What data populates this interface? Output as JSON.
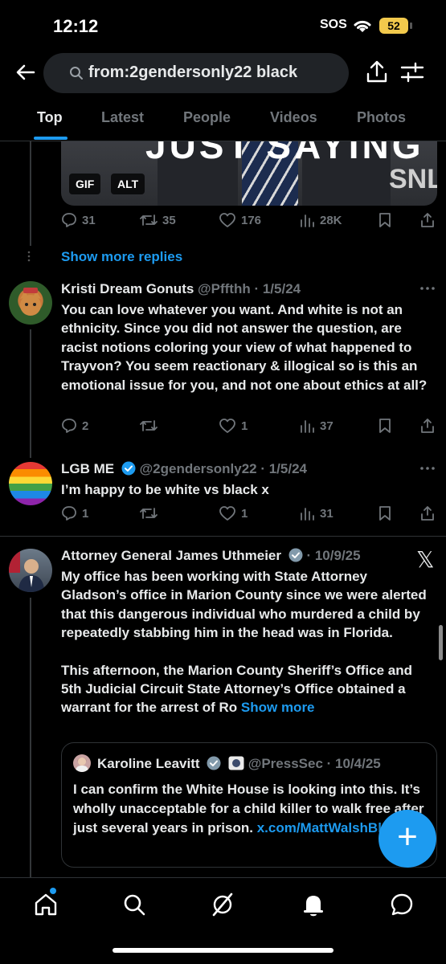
{
  "status_bar": {
    "time": "12:12",
    "sos": "SOS",
    "battery": "52"
  },
  "search": {
    "query": "from:2gendersonly22 black"
  },
  "tabs": [
    "Top",
    "Latest",
    "People",
    "Videos",
    "Photos"
  ],
  "active_tab": "Top",
  "media_card": {
    "caption": "JUST SAYING",
    "watermark": "SNL",
    "badges": {
      "gif": "GIF",
      "alt": "ALT"
    },
    "stats": {
      "replies": "31",
      "reposts": "35",
      "likes": "176",
      "views": "28K"
    }
  },
  "show_more_replies": "Show more replies",
  "tweets": [
    {
      "name": "Kristi Dream Gonuts",
      "handle": "@Pffthh",
      "date": "· 1/5/24",
      "body": "You can love whatever you want. And white is not an ethnicity.  Since you did not answer the question, are racist notions coloring your view of what happened to Trayvon? You seem reactionary & illogical so is this an emotional issue for you, and not one about ethics at all?",
      "stats": {
        "replies": "2",
        "reposts": "",
        "likes": "1",
        "views": "37"
      }
    },
    {
      "name": "LGB ME",
      "handle": "@2gendersonly22",
      "date": "· 1/5/24",
      "body": "I’m happy to be white vs black x",
      "stats": {
        "replies": "1",
        "reposts": "",
        "likes": "1",
        "views": "31"
      }
    },
    {
      "name": "Attorney General James Uthmeier",
      "handle": "",
      "date": "· 10/9/25",
      "body_p1": "My office has been working with State Attorney Gladson’s office in Marion County since we were alerted that this dangerous individual who murdered a child by repeatedly stabbing him in the head was in Florida.",
      "body_p2": "This afternoon, the Marion County Sheriff’s Office and 5th Judicial Circuit State Attorney’s Office obtained a warrant for the arrest of Ro",
      "show_more": "Show more"
    }
  ],
  "quoted_tweet": {
    "name": "Karoline Leavitt",
    "handle": "@PressSec",
    "date": "· 10/4/25",
    "body": "I can confirm the White House is looking into this. It’s wholly unacceptable for a child killer to walk free after just several years in prison.",
    "link": "x.com/MattWalshBlog/…"
  },
  "brand_logo": "𝕏",
  "fab_label": "+",
  "colors": {
    "accent": "#1d9bf0",
    "background": "#000000",
    "muted": "#71767b",
    "text": "#e7e9ea"
  },
  "bottom_nav": [
    "home-icon",
    "search-icon",
    "grok-icon",
    "notifications-icon",
    "messages-icon"
  ]
}
